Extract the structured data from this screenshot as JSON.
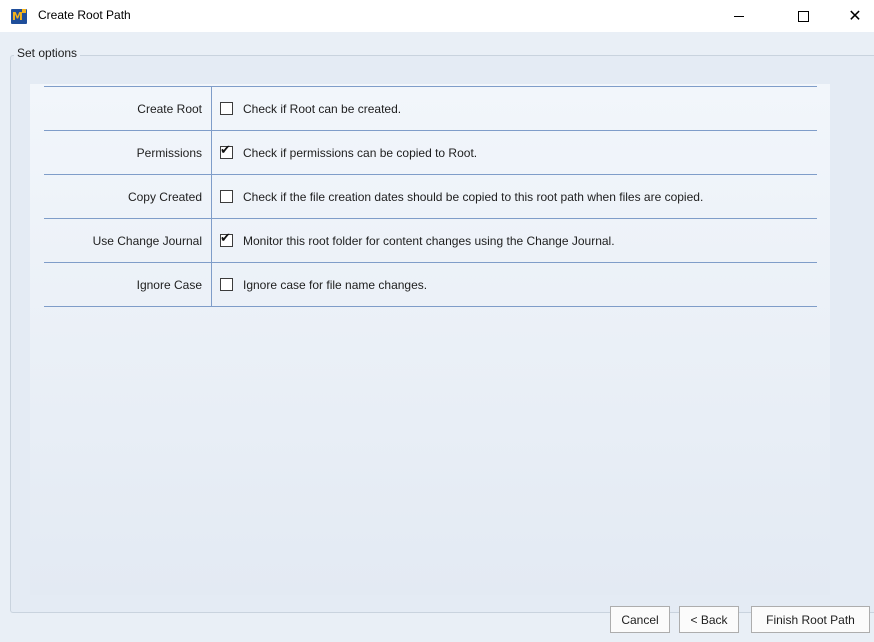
{
  "window": {
    "title": "Create Root Path",
    "icon": "app-logo-icon",
    "controls": [
      "minimize",
      "maximize",
      "close"
    ]
  },
  "group": {
    "legend": "Set options"
  },
  "options": [
    {
      "label": "Create Root",
      "checked": false,
      "description": "Check if Root can be created."
    },
    {
      "label": "Permissions",
      "checked": true,
      "description": "Check if permissions can be copied to Root."
    },
    {
      "label": "Copy Created",
      "checked": false,
      "description": "Check if the file creation dates should be copied to this root path when files are copied."
    },
    {
      "label": "Use Change Journal",
      "checked": true,
      "description": "Monitor this root folder for content changes using the Change Journal."
    },
    {
      "label": "Ignore Case",
      "checked": false,
      "description": "Ignore case for file name changes."
    }
  ],
  "buttons": {
    "cancel": "Cancel",
    "back": "< Back",
    "finish": "Finish Root Path"
  },
  "glyphs": {
    "check": "✔",
    "close": "✕"
  },
  "colors": {
    "grid_line": "#7f9dc9",
    "background": "#e9eff6"
  }
}
